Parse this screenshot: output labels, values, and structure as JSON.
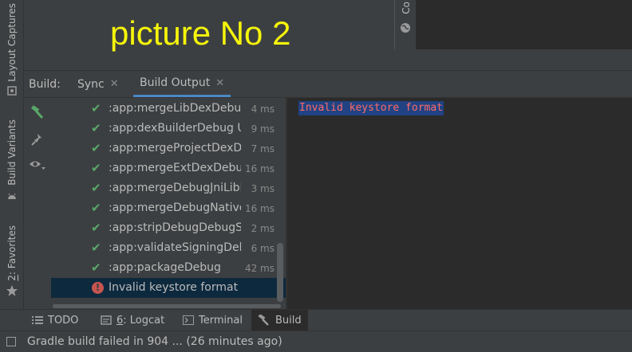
{
  "picture_title": "picture No 2",
  "left_strip": {
    "layout_captures": "Layout Captures",
    "build_variants": "Build Variants",
    "favorites_num": "2",
    "favorites": ": Favorites"
  },
  "top_right_strip": {
    "label": "Co"
  },
  "build_header": {
    "label": "Build:",
    "tabs": [
      {
        "label": "Sync"
      },
      {
        "label": "Build Output"
      }
    ]
  },
  "tree": {
    "rows": [
      {
        "name": ":app:mergeLibDexDebug",
        "time": "4 ms"
      },
      {
        "name": ":app:dexBuilderDebug UI",
        "time": "9 ms"
      },
      {
        "name": ":app:mergeProjectDexDe",
        "time": "7 ms"
      },
      {
        "name": ":app:mergeExtDexDebu",
        "time": "16 ms"
      },
      {
        "name": ":app:mergeDebugJniLibF",
        "time": "3 ms"
      },
      {
        "name": ":app:mergeDebugNative",
        "time": "16 ms"
      },
      {
        "name": ":app:stripDebugDebugSy",
        "time": "2 ms"
      },
      {
        "name": ":app:validateSigningDebu",
        "time": "6 ms"
      },
      {
        "name": ":app:packageDebug",
        "time": "42 ms"
      }
    ],
    "error": {
      "name": "Invalid keystore format"
    }
  },
  "output": {
    "line": "Invalid keystore format"
  },
  "bottom_tabs": {
    "todo": "TODO",
    "logcat_num": "6",
    "logcat": ": Logcat",
    "terminal": "Terminal",
    "build": "Build"
  },
  "status": {
    "text": "Gradle build failed in 904 ... (26 minutes ago)"
  },
  "colors": {
    "success": "#59a869",
    "error": "#c75450",
    "title_yellow": "#f5f50a",
    "output_error_text": "#ff6b68",
    "selection": "#214283"
  }
}
